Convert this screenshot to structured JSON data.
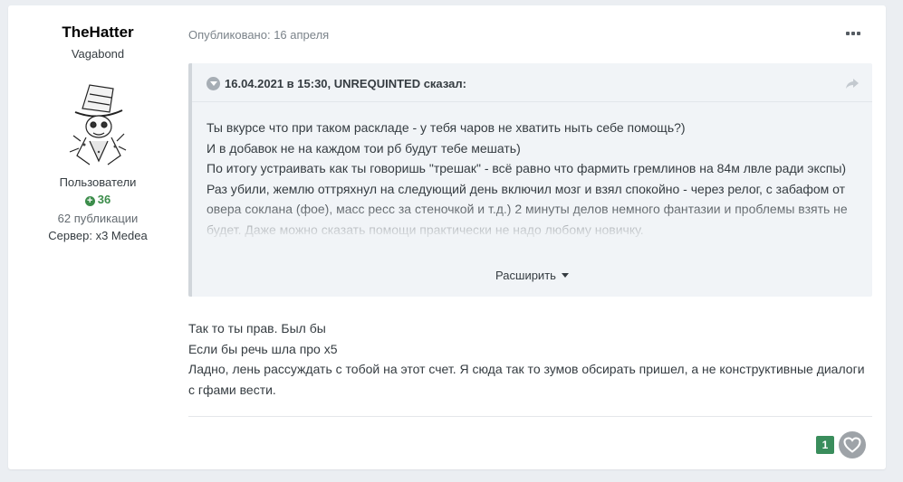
{
  "author": {
    "name": "TheHatter",
    "title": "Vagabond",
    "group": "Пользователи",
    "reputation": "36",
    "posts": "62 публикации",
    "server": "Сервер: x3 Medea"
  },
  "post": {
    "published": "Опубликовано: 16 апреля",
    "quote": {
      "header": "16.04.2021 в 15:30, UNREQUINTED сказал:",
      "lines": [
        "Ты вкурсе что при таком раскладе - у тебя чаров не хватить ныть себе помощь?)",
        "И в добавок не на каждом тои рб будут тебе мешать)",
        "По итогу устраивать как ты говоришь \"трешак\" - всё равно что фармить гремлинов на 84м лвле ради экспы)",
        "Раз убили, жемлю оттряхнул на следующий день включил мозг и взял спокойно - через релог, с забафом от овера соклана (фое), масс ресс за стеночкой и т.д.) 2 минуты делов немного фантазии и проблемы взять не будет. Даже можно сказать помощи практически не надо любому новичку."
      ],
      "expand_label": "Расширить"
    },
    "body": [
      "Так то ты прав. Был бы",
      "Если бы речь шла про х5",
      "Ладно, лень рассуждать с тобой на этот счет. Я сюда так то зумов обсирать пришел, а не конструктивные диалоги с гфами вести."
    ],
    "reaction_count": "1"
  },
  "icons": {
    "more": "more-horizontal-icon",
    "collapse": "chevron-down-circle-icon",
    "share": "share-arrow-icon",
    "reputation": "plus-circle-icon",
    "like": "heart-icon"
  },
  "colors": {
    "reputation_green": "#3c8d4b",
    "reaction_badge": "#3a8d5c",
    "quote_bg": "#f1f4f7"
  }
}
